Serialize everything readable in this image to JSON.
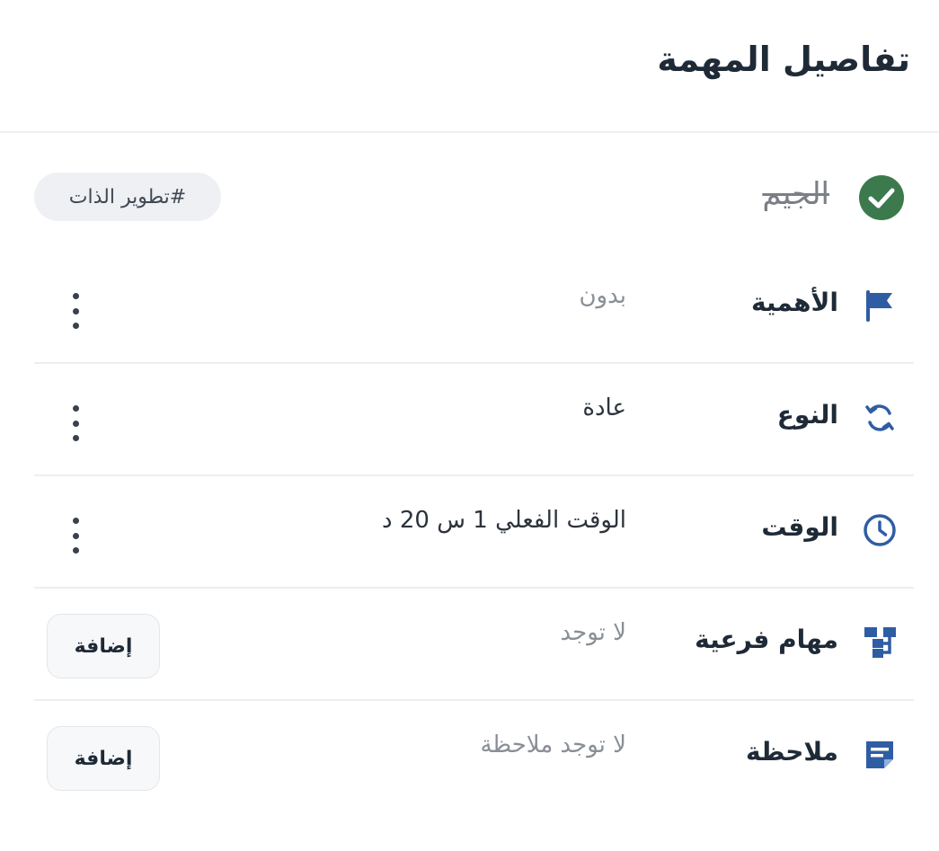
{
  "header": {
    "title": "تفاصيل المهمة"
  },
  "task": {
    "name": "الجيم",
    "tag": "#تطوير الذات",
    "status_icon": "check-circle-icon",
    "status_color": "#3c7a4e"
  },
  "accent_color": "#2f5da4",
  "rows": [
    {
      "icon": "flag-icon",
      "label": "الأهمية",
      "value": "بدون",
      "action": "more"
    },
    {
      "icon": "repeat-icon",
      "label": "النوع",
      "value": "عادة",
      "action": "more"
    },
    {
      "icon": "clock-icon",
      "label": "الوقت",
      "value": "الوقت الفعلي 1 س 20 د",
      "action": "more"
    },
    {
      "icon": "subtasks-icon",
      "label": "مهام فرعية",
      "value": "لا توجد",
      "action": "add",
      "action_label": "إضافة"
    },
    {
      "icon": "note-icon",
      "label": "ملاحظة",
      "value": "لا توجد ملاحظة",
      "action": "add",
      "action_label": "إضافة"
    }
  ]
}
